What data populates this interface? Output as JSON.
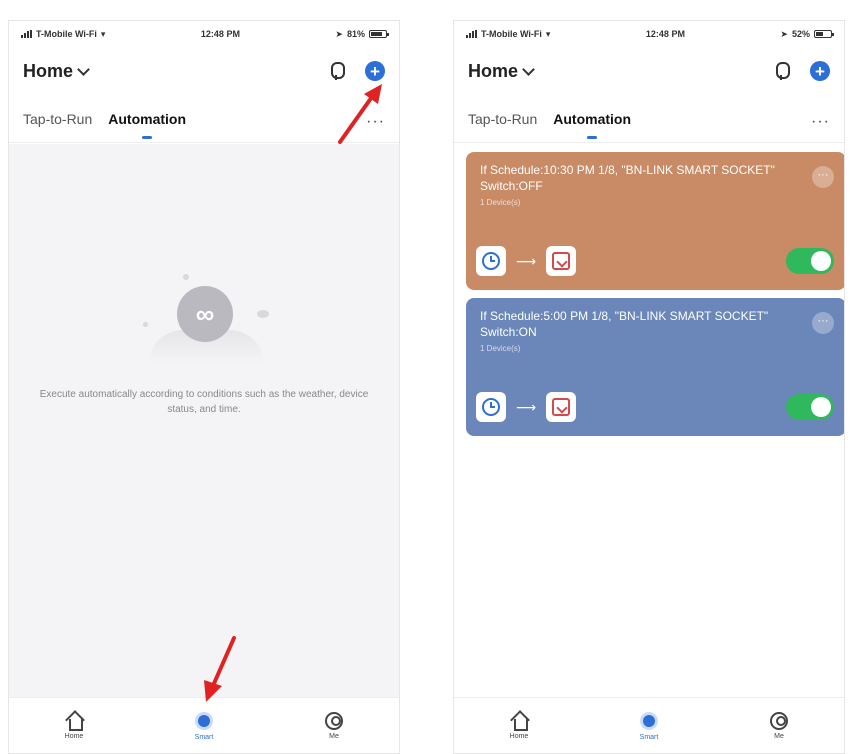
{
  "colors": {
    "accent": "#2d6fd6",
    "card_off": "#c98b66",
    "card_on": "#6b86b9",
    "toggle_on": "#2fb85c",
    "annotation_arrow": "#e02222"
  },
  "left_screen": {
    "status": {
      "carrier": "T-Mobile Wi-Fi",
      "time": "12:48 PM",
      "battery_text": "81%",
      "battery_level": 0.81
    },
    "header": {
      "title": "Home",
      "icons": [
        "chevron-down-icon",
        "mic-icon",
        "add-icon"
      ]
    },
    "tabs": [
      {
        "label": "Tap-to-Run"
      },
      {
        "label": "Automation",
        "active": true
      }
    ],
    "empty_state": {
      "message": "Execute automatically according to conditions such as the weather, device status, and time."
    },
    "tabbar": [
      {
        "label": "Home"
      },
      {
        "label": "Smart",
        "active": true
      },
      {
        "label": "Me"
      }
    ]
  },
  "right_screen": {
    "status": {
      "carrier": "T-Mobile Wi-Fi",
      "time": "12:48 PM",
      "battery_text": "52%",
      "battery_level": 0.52
    },
    "header": {
      "title": "Home",
      "icons": [
        "chevron-down-icon",
        "mic-icon",
        "add-icon"
      ]
    },
    "tabs": [
      {
        "label": "Tap-to-Run"
      },
      {
        "label": "Automation",
        "active": true
      }
    ],
    "cards": [
      {
        "title": "If Schedule:10:30 PM 1/8, \"BN-LINK SMART SOCKET\" Switch:OFF",
        "subtitle": "1 Device(s)",
        "enabled": true
      },
      {
        "title": "If Schedule:5:00 PM 1/8, \"BN-LINK SMART SOCKET\" Switch:ON",
        "subtitle": "1 Device(s)",
        "enabled": true
      }
    ],
    "tabbar": [
      {
        "label": "Home"
      },
      {
        "label": "Smart",
        "active": true
      },
      {
        "label": "Me"
      }
    ]
  }
}
